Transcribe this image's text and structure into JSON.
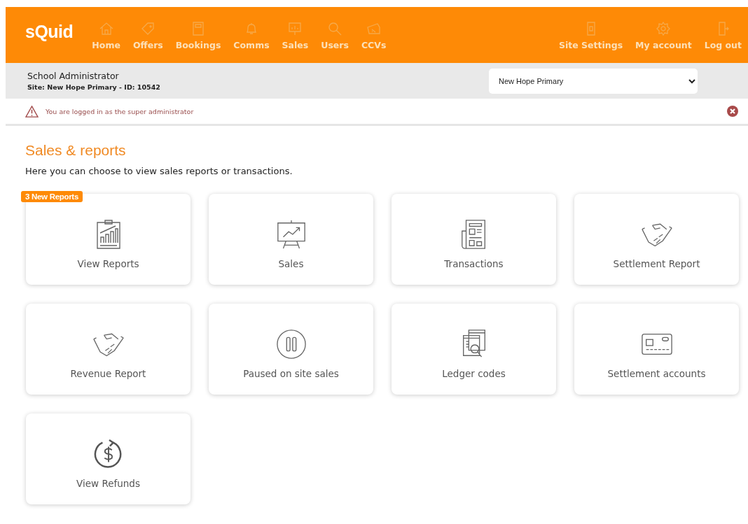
{
  "brand": "sQuid",
  "nav": [
    {
      "label": "Home"
    },
    {
      "label": "Offers"
    },
    {
      "label": "Bookings"
    },
    {
      "label": "Comms"
    },
    {
      "label": "Sales"
    },
    {
      "label": "Users"
    },
    {
      "label": "CCVs"
    }
  ],
  "nav_right": [
    {
      "label": "Site Settings"
    },
    {
      "label": "My account"
    },
    {
      "label": "Log out"
    }
  ],
  "user": {
    "role": "School Administrator",
    "site": "Site: New Hope Primary - ID: 10542"
  },
  "site_select": {
    "value": "New Hope Primary"
  },
  "alert": {
    "text": "You are logged in as the super administrator"
  },
  "page": {
    "title": "Sales & reports",
    "intro": "Here you can choose to view sales reports or transactions."
  },
  "tiles": [
    {
      "label": "View Reports",
      "badge": "3 New Reports"
    },
    {
      "label": "Sales"
    },
    {
      "label": "Transactions"
    },
    {
      "label": "Settlement Report"
    },
    {
      "label": "Revenue Report"
    },
    {
      "label": "Paused on site sales"
    },
    {
      "label": "Ledger codes"
    },
    {
      "label": "Settlement accounts"
    },
    {
      "label": "View Refunds"
    }
  ]
}
